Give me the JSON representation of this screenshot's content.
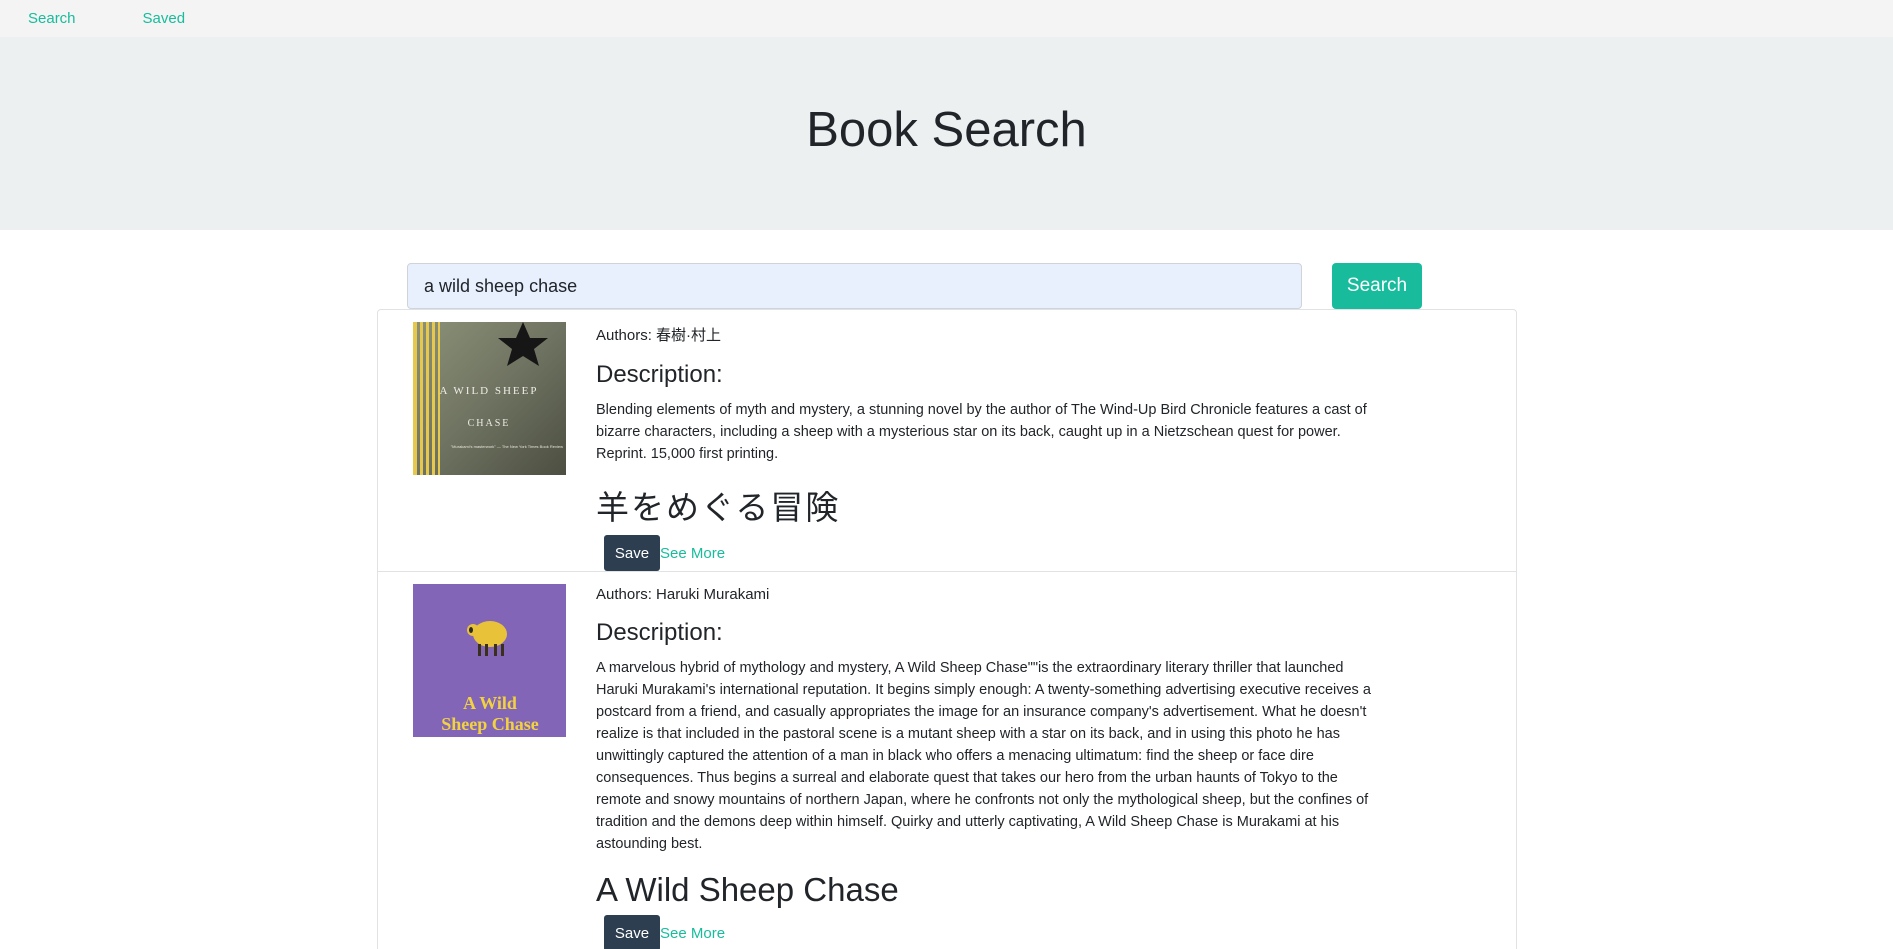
{
  "nav": {
    "search": "Search",
    "saved": "Saved"
  },
  "header": {
    "title": "Book Search"
  },
  "search": {
    "value": "a wild sheep chase",
    "button": "Search"
  },
  "results": [
    {
      "authors": "Authors: 春樹·村上",
      "description_heading": "Description:",
      "description": "Blending elements of myth and mystery, a stunning novel by the author of The Wind-Up Bird Chronicle features a cast of bizarre characters, including a sheep with a mysterious star on its back, caught up in a Nietzschean quest for power. Reprint. 15,000 first printing.",
      "title": "羊をめぐる冒険",
      "save": "Save",
      "see_more": "See More",
      "cover": {
        "line1": "A WILD SHEEP",
        "line2": "CHASE",
        "blurb": "\"Murakami's masterwork\" — The New York Times Book Review"
      }
    },
    {
      "authors": "Authors: Haruki Murakami",
      "description_heading": "Description:",
      "description": "A marvelous hybrid of mythology and mystery, A Wild Sheep Chase\"\"is the extraordinary literary thriller that launched Haruki Murakami's international reputation. It begins simply enough: A twenty-something advertising executive receives a postcard from a friend, and casually appropriates the image for an insurance company's advertisement. What he doesn't realize is that included in the pastoral scene is a mutant sheep with a star on its back, and in using this photo he has unwittingly captured the attention of a man in black who offers a menacing ultimatum: find the sheep or face dire consequences. Thus begins a surreal and elaborate quest that takes our hero from the urban haunts of Tokyo to the remote and snowy mountains of northern Japan, where he confronts not only the mythological sheep, but the confines of tradition and the demons deep within himself. Quirky and utterly captivating, A Wild Sheep Chase is Murakami at his astounding best.",
      "title": "A Wild Sheep Chase",
      "save": "Save",
      "see_more": "See More",
      "cover": {
        "line1": "A Wild",
        "line2": "Sheep Chase"
      }
    }
  ]
}
